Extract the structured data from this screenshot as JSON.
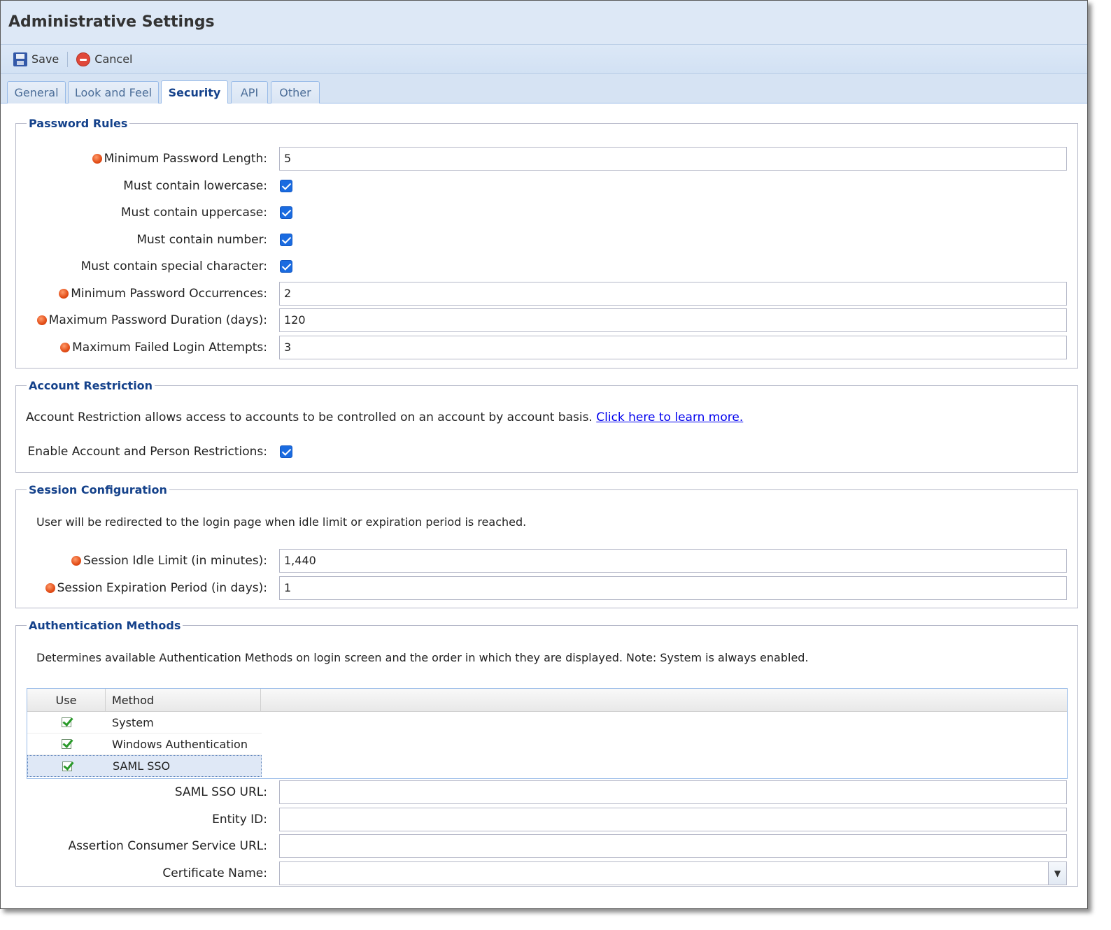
{
  "window": {
    "title": "Administrative Settings"
  },
  "toolbar": {
    "save_label": "Save",
    "cancel_label": "Cancel"
  },
  "tabs": [
    {
      "label": "General",
      "active": false
    },
    {
      "label": "Look and Feel",
      "active": false
    },
    {
      "label": "Security",
      "active": true
    },
    {
      "label": "API",
      "active": false
    },
    {
      "label": "Other",
      "active": false
    }
  ],
  "password_rules": {
    "legend": "Password Rules",
    "min_length": {
      "label": "Minimum Password Length:",
      "value": "5",
      "required": true
    },
    "lowercase": {
      "label": "Must contain lowercase:",
      "checked": true
    },
    "uppercase": {
      "label": "Must contain uppercase:",
      "checked": true
    },
    "number": {
      "label": "Must contain number:",
      "checked": true
    },
    "special": {
      "label": "Must contain special character:",
      "checked": true
    },
    "min_occurrences": {
      "label": "Minimum Password Occurrences:",
      "value": "2",
      "required": true
    },
    "max_duration": {
      "label": "Maximum Password Duration (days):",
      "value": "120",
      "required": true
    },
    "max_failed": {
      "label": "Maximum Failed Login Attempts:",
      "value": "3",
      "required": true
    }
  },
  "account_restriction": {
    "legend": "Account Restriction",
    "description": "Account Restriction allows access to accounts to be controlled on an account by account basis.",
    "link": "Click here to learn more.",
    "enable": {
      "label": "Enable Account and Person Restrictions:",
      "checked": true
    }
  },
  "session": {
    "legend": "Session Configuration",
    "description": "User will be redirected to the login page when idle limit or expiration period is reached.",
    "idle_limit": {
      "label": "Session Idle Limit (in minutes):",
      "value": "1,440",
      "required": true
    },
    "expiration": {
      "label": "Session Expiration Period (in days):",
      "value": "1",
      "required": true
    }
  },
  "auth_methods": {
    "legend": "Authentication Methods",
    "description": "Determines available Authentication Methods on login screen and the order in which they are displayed. Note: System is always enabled.",
    "columns": [
      "Use",
      "Method"
    ],
    "rows": [
      {
        "use": true,
        "method": "System"
      },
      {
        "use": true,
        "method": "Windows Authentication"
      },
      {
        "use": true,
        "method": "SAML SSO",
        "selected": true
      }
    ],
    "saml_url": {
      "label": "SAML SSO URL:",
      "value": ""
    },
    "entity_id": {
      "label": "Entity ID:",
      "value": ""
    },
    "acs_url": {
      "label": "Assertion Consumer Service URL:",
      "value": ""
    },
    "certificate": {
      "label": "Certificate Name:",
      "value": ""
    }
  },
  "colors": {
    "accent": "#15428b",
    "required": "#e24d17",
    "checkbox": "#1a6be0"
  }
}
